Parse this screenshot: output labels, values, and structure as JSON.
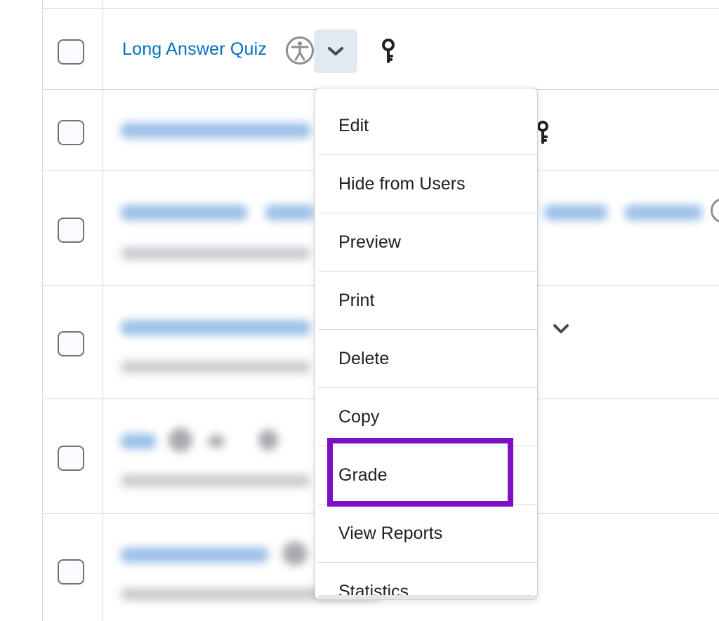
{
  "quiz_row": {
    "title": "Long Answer Quiz"
  },
  "icons": {
    "accessibility": "accessibility-icon",
    "dropdown": "chevron-down-icon",
    "release_conditions": "key-icon"
  },
  "context_menu": {
    "items": [
      {
        "label": "Edit"
      },
      {
        "label": "Hide from Users"
      },
      {
        "label": "Preview"
      },
      {
        "label": "Print"
      },
      {
        "label": "Delete"
      },
      {
        "label": "Copy"
      },
      {
        "label": "Grade"
      },
      {
        "label": "View Reports"
      },
      {
        "label": "Statistics"
      }
    ],
    "highlighted_item": "Grade"
  },
  "colors": {
    "link": "#006fbf",
    "highlight": "#7d10c0",
    "toggle_bg": "#e3e9f1"
  }
}
